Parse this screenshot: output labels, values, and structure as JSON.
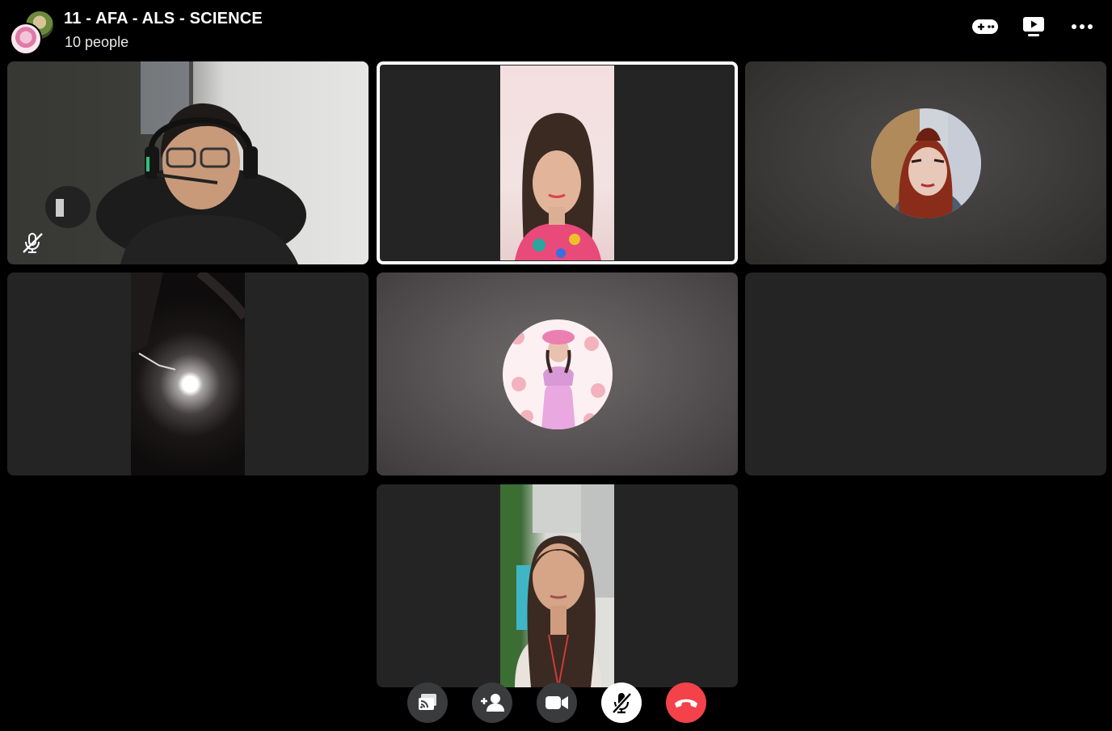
{
  "header": {
    "title": "11 - AFA - ALS - SCIENCE",
    "subtitle": "10 people",
    "actions": [
      {
        "name": "game-controller-icon"
      },
      {
        "name": "watch-together-icon"
      },
      {
        "name": "more-options-icon"
      }
    ]
  },
  "participants": [
    {
      "id": "p1",
      "kind": "video",
      "muted": true
    },
    {
      "id": "p2",
      "kind": "video",
      "active_speaker": true
    },
    {
      "id": "p3",
      "kind": "profile-picture"
    },
    {
      "id": "p4",
      "kind": "video"
    },
    {
      "id": "p5",
      "kind": "profile-picture"
    },
    {
      "id": "p6",
      "kind": "empty"
    },
    {
      "id": "p7",
      "kind": "video"
    }
  ],
  "controls": [
    {
      "name": "share-screen-icon"
    },
    {
      "name": "add-person-icon"
    },
    {
      "name": "camera-icon"
    },
    {
      "name": "microphone-muted-icon"
    },
    {
      "name": "end-call-icon"
    }
  ],
  "colors": {
    "background": "#000000",
    "tile": "#242424",
    "control_button": "#3a3b3c",
    "end_call": "#f3424a",
    "active_border": "#ffffff"
  }
}
